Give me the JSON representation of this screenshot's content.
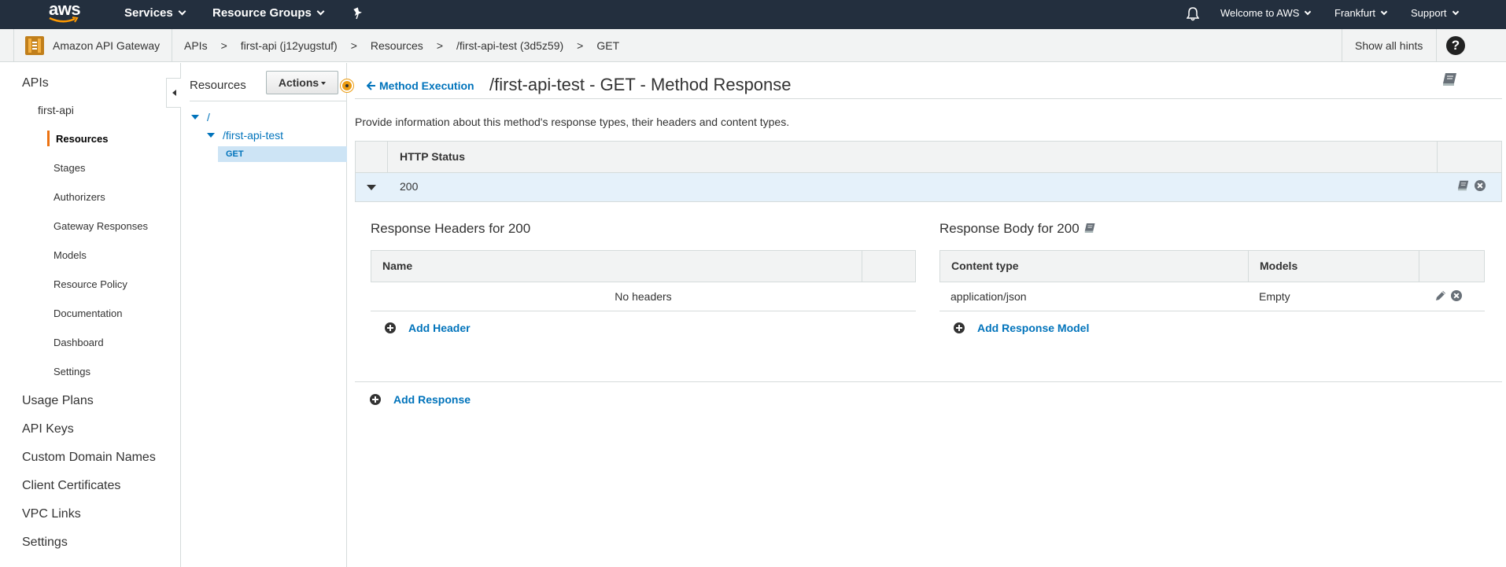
{
  "topnav": {
    "logo_text": "aws",
    "services": "Services",
    "resource_groups": "Resource Groups",
    "welcome": "Welcome to AWS",
    "region": "Frankfurt",
    "support": "Support",
    "background_color": "#232f3e"
  },
  "breadcrumb": {
    "service": "Amazon API Gateway",
    "items": [
      "APIs",
      "first-api (j12yugstuf)",
      "Resources",
      "/first-api-test (3d5z59)",
      "GET"
    ],
    "separator": ">",
    "show_hints": "Show all hints",
    "help": "?"
  },
  "sidebar": {
    "apis": "APIs",
    "api_name": "first-api",
    "sub_items": [
      "Resources",
      "Stages",
      "Authorizers",
      "Gateway Responses",
      "Models",
      "Resource Policy",
      "Documentation",
      "Dashboard",
      "Settings"
    ],
    "active_item": "Resources",
    "bottom_items": [
      "Usage Plans",
      "API Keys",
      "Custom Domain Names",
      "Client Certificates",
      "VPC Links",
      "Settings"
    ]
  },
  "resources_panel": {
    "title": "Resources",
    "actions_label": "Actions",
    "tree": {
      "root": "/",
      "child": "/first-api-test",
      "method": "GET"
    }
  },
  "main": {
    "back_link": "Method Execution",
    "title": "/first-api-test - GET - Method Response",
    "description": "Provide information about this method's response types, their headers and content types.",
    "http_status_header": "HTTP Status",
    "status_code": "200",
    "response_headers": {
      "title": "Response Headers for 200",
      "col_name": "Name",
      "empty_text": "No headers",
      "add_label": "Add Header"
    },
    "response_body": {
      "title": "Response Body for 200",
      "col_content_type": "Content type",
      "col_models": "Models",
      "rows": [
        {
          "content_type": "application/json",
          "model": "Empty"
        }
      ],
      "add_label": "Add Response Model"
    },
    "add_response": "Add Response"
  },
  "colors": {
    "link": "#0073bb",
    "accent": "#ec7211",
    "selected_row": "#e5f1fa"
  }
}
